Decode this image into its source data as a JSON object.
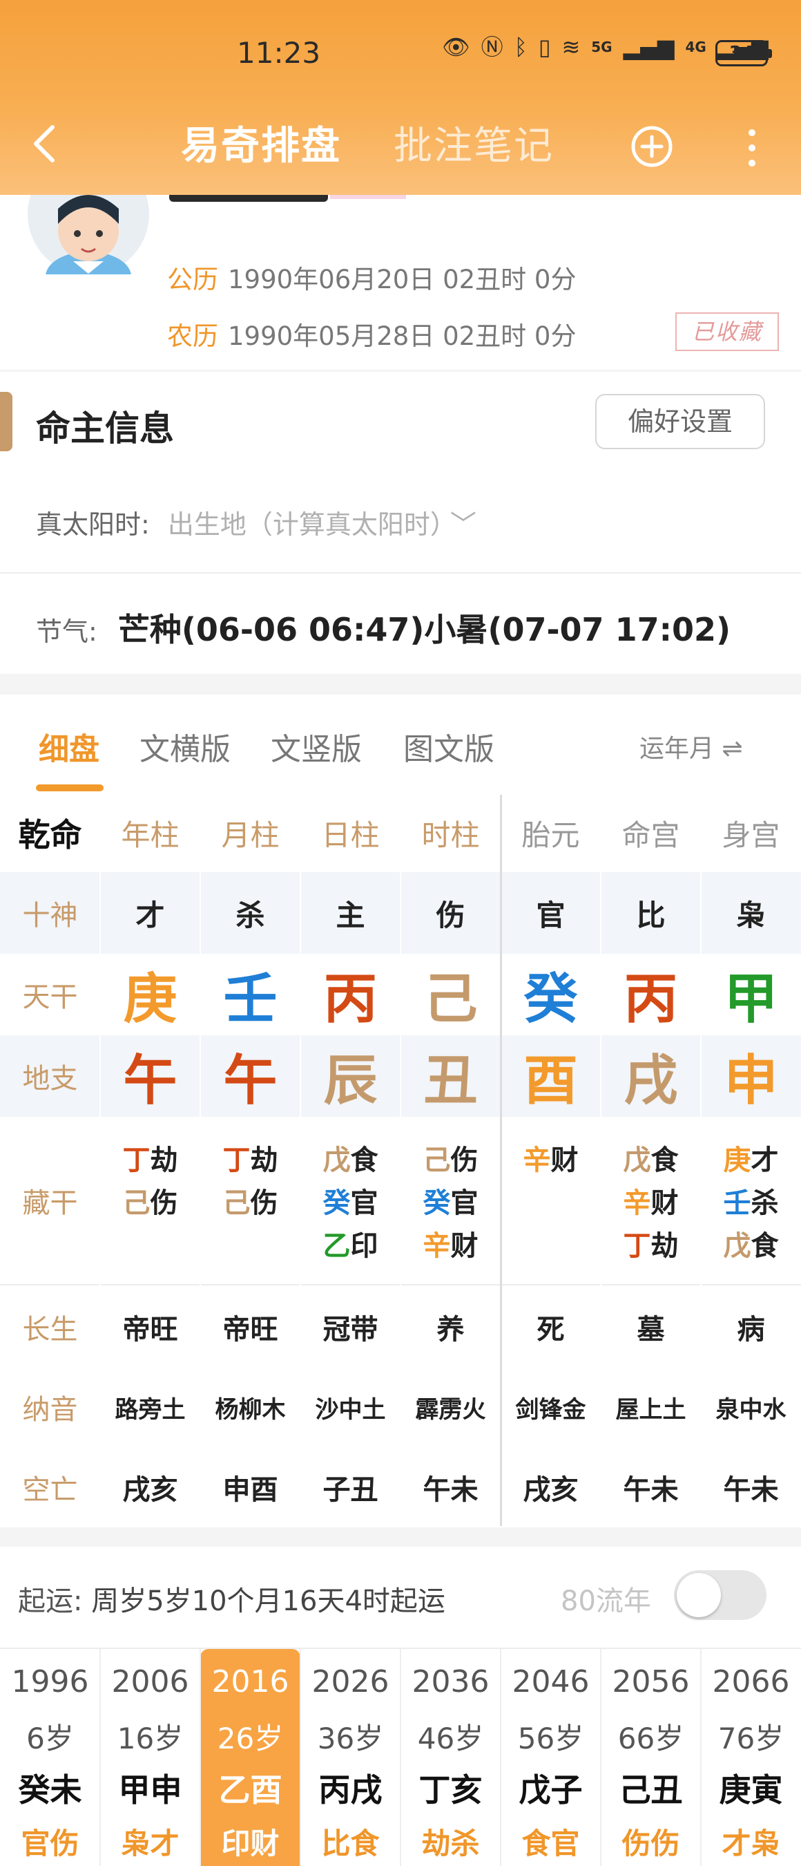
{
  "status_bar": {
    "time": "11:23",
    "battery": "34",
    "net1": "5G",
    "net2": "4G"
  },
  "nav": {
    "tab_active": "易奇排盘",
    "tab_other": "批注笔记"
  },
  "profile": {
    "solar_label": "公历",
    "solar_value": "1990年06月20日 02丑时 0分",
    "lunar_label": "农历",
    "lunar_value": "1990年05月28日 02丑时 0分",
    "stamp": "已收藏"
  },
  "info": {
    "title": "命主信息",
    "pref_button": "偏好设置",
    "solar_time_label": "真太阳时:",
    "solar_time_value": "出生地（计算真太阳时）",
    "term_label": "节气:",
    "term_value": "芒种(06-06 06:47)小暑(07-07 17:02)"
  },
  "chart_tabs": [
    "细盘",
    "文横版",
    "文竖版",
    "图文版"
  ],
  "yun_toggle": "运年月",
  "grid": {
    "headers": [
      "乾命",
      "年柱",
      "月柱",
      "日柱",
      "时柱",
      "胎元",
      "命宫",
      "身宫"
    ],
    "row_labels": [
      "十神",
      "天干",
      "地支",
      "藏干",
      "长生",
      "纳音",
      "空亡"
    ],
    "shishen": [
      "才",
      "杀",
      "主",
      "伤",
      "官",
      "比",
      "枭"
    ],
    "tiangan": [
      {
        "c": "庚",
        "color": "#f39a2c"
      },
      {
        "c": "壬",
        "color": "#1f7fd6"
      },
      {
        "c": "丙",
        "color": "#d44a14"
      },
      {
        "c": "己",
        "color": "#c49a6c"
      },
      {
        "c": "癸",
        "color": "#1f7fd6"
      },
      {
        "c": "丙",
        "color": "#d44a14"
      },
      {
        "c": "甲",
        "color": "#239a2a"
      }
    ],
    "dizhi": [
      {
        "c": "午",
        "color": "#d44a14"
      },
      {
        "c": "午",
        "color": "#d44a14"
      },
      {
        "c": "辰",
        "color": "#c49a6c"
      },
      {
        "c": "丑",
        "color": "#c49a6c"
      },
      {
        "c": "酉",
        "color": "#f39a2c"
      },
      {
        "c": "戌",
        "color": "#c49a6c"
      },
      {
        "c": "申",
        "color": "#f39a2c"
      }
    ],
    "canggan": [
      [
        {
          "g": "丁",
          "color": "#d44a14",
          "w": "劫"
        },
        {
          "g": "己",
          "color": "#c49a6c",
          "w": "伤"
        }
      ],
      [
        {
          "g": "丁",
          "color": "#d44a14",
          "w": "劫"
        },
        {
          "g": "己",
          "color": "#c49a6c",
          "w": "伤"
        }
      ],
      [
        {
          "g": "戊",
          "color": "#c49a6c",
          "w": "食"
        },
        {
          "g": "癸",
          "color": "#1f7fd6",
          "w": "官"
        },
        {
          "g": "乙",
          "color": "#239a2a",
          "w": "印"
        }
      ],
      [
        {
          "g": "己",
          "color": "#c49a6c",
          "w": "伤"
        },
        {
          "g": "癸",
          "color": "#1f7fd6",
          "w": "官"
        },
        {
          "g": "辛",
          "color": "#f39a2c",
          "w": "财"
        }
      ],
      [
        {
          "g": "辛",
          "color": "#f39a2c",
          "w": "财"
        }
      ],
      [
        {
          "g": "戊",
          "color": "#c49a6c",
          "w": "食"
        },
        {
          "g": "辛",
          "color": "#f39a2c",
          "w": "财"
        },
        {
          "g": "丁",
          "color": "#d44a14",
          "w": "劫"
        }
      ],
      [
        {
          "g": "庚",
          "color": "#f39a2c",
          "w": "才"
        },
        {
          "g": "壬",
          "color": "#1f7fd6",
          "w": "杀"
        },
        {
          "g": "戊",
          "color": "#c49a6c",
          "w": "食"
        }
      ]
    ],
    "changsheng": [
      "帝旺",
      "帝旺",
      "冠带",
      "养",
      "死",
      "墓",
      "病"
    ],
    "nayin": [
      "路旁土",
      "杨柳木",
      "沙中土",
      "霹雳火",
      "剑锋金",
      "屋上土",
      "泉中水"
    ],
    "kongwang": [
      "戌亥",
      "申酉",
      "子丑",
      "午未",
      "戌亥",
      "午未",
      "午未"
    ]
  },
  "qiyun": {
    "label": "起运:",
    "value": "周岁5岁10个月16天4时起运",
    "liunian": "80流年"
  },
  "dayun": [
    {
      "year": "1996",
      "age": "6岁",
      "gz": "癸未",
      "ss": "官伤"
    },
    {
      "year": "2006",
      "age": "16岁",
      "gz": "甲申",
      "ss": "枭才"
    },
    {
      "year": "2016",
      "age": "26岁",
      "gz": "乙酉",
      "ss": "印财",
      "selected": true
    },
    {
      "year": "2026",
      "age": "36岁",
      "gz": "丙戌",
      "ss": "比食"
    },
    {
      "year": "2036",
      "age": "46岁",
      "gz": "丁亥",
      "ss": "劫杀"
    },
    {
      "year": "2046",
      "age": "56岁",
      "gz": "戊子",
      "ss": "食官"
    },
    {
      "year": "2056",
      "age": "66岁",
      "gz": "己丑",
      "ss": "伤伤"
    },
    {
      "year": "2066",
      "age": "76岁",
      "gz": "庚寅",
      "ss": "才枭"
    }
  ]
}
